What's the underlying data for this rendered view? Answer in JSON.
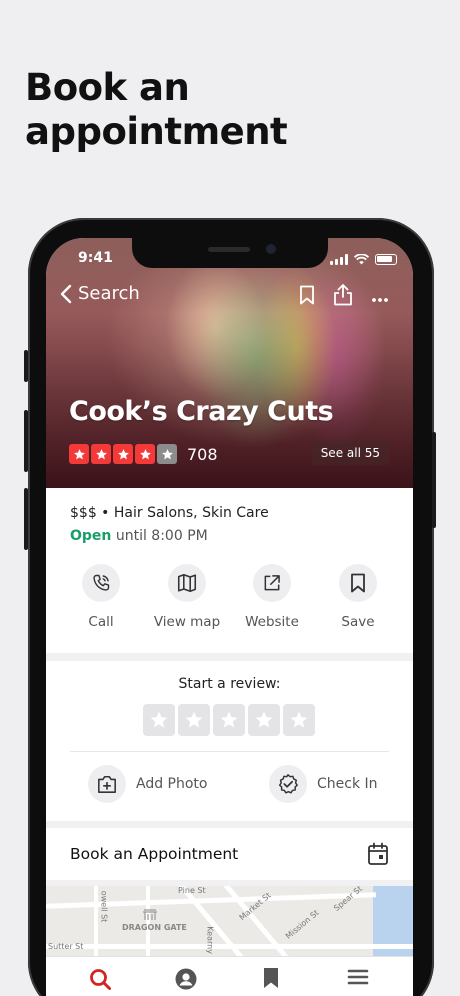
{
  "headline": "Book an appointment",
  "status_bar": {
    "time": "9:41"
  },
  "nav": {
    "back_label": "Search"
  },
  "business": {
    "name": "Cook’s Crazy Cuts",
    "rating": 4,
    "max_rating": 5,
    "review_count": "708",
    "see_all_label": "See all 55",
    "categories": "$$$ • Hair Salons, Skin Care",
    "open_status": "Open",
    "hours_text": "until 8:00 PM"
  },
  "actions": [
    {
      "label": "Call",
      "icon": "phone-icon"
    },
    {
      "label": "View map",
      "icon": "map-icon"
    },
    {
      "label": "Website",
      "icon": "external-link-icon"
    },
    {
      "label": "Save",
      "icon": "bookmark-icon"
    }
  ],
  "review": {
    "title": "Start a review:",
    "add_photo_label": "Add Photo",
    "check_in_label": "Check In"
  },
  "appointment": {
    "label": "Book an Appointment"
  },
  "map": {
    "labels": [
      "Pine St",
      "Market St",
      "Spear St",
      "Mission St",
      "DRAGON GATE",
      "Sutter St",
      "owell St",
      "Kearny St"
    ]
  },
  "tabs": [
    {
      "name": "search",
      "icon": "search-icon",
      "active": true
    },
    {
      "name": "me",
      "icon": "profile-icon",
      "active": false
    },
    {
      "name": "collections",
      "icon": "bookmark-icon",
      "active": false
    },
    {
      "name": "more",
      "icon": "menu-icon",
      "active": false
    }
  ],
  "colors": {
    "brand_red": "#d32323",
    "star_red": "#f43939",
    "open_green": "#1a9e6a"
  }
}
